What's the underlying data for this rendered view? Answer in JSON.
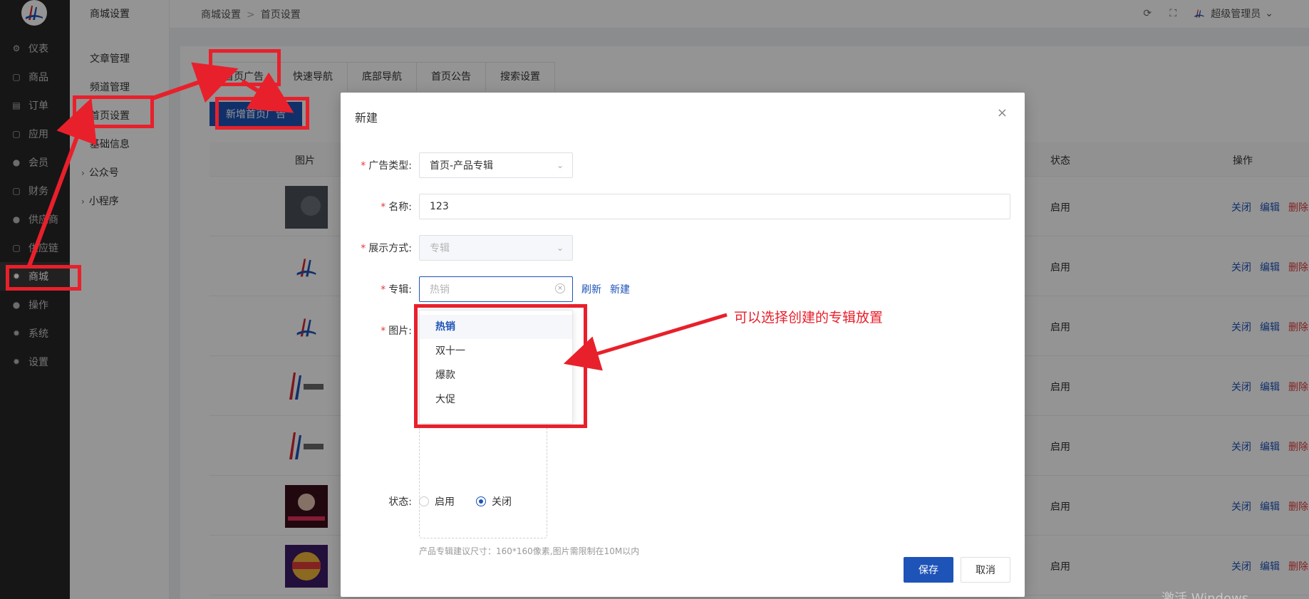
{
  "nav": {
    "items": [
      {
        "label": "仪表",
        "icon": "dashboard-icon",
        "glyph": "⚙"
      },
      {
        "label": "商品",
        "icon": "bag-icon",
        "glyph": "▢"
      },
      {
        "label": "订单",
        "icon": "order-icon",
        "glyph": "▤"
      },
      {
        "label": "应用",
        "icon": "app-icon",
        "glyph": "▢"
      },
      {
        "label": "会员",
        "icon": "user-icon",
        "glyph": "●"
      },
      {
        "label": "财务",
        "icon": "finance-icon",
        "glyph": "▢"
      },
      {
        "label": "供应商",
        "icon": "supplier-icon",
        "glyph": "●"
      },
      {
        "label": "供应链",
        "icon": "chain-icon",
        "glyph": "▢"
      },
      {
        "label": "商城",
        "icon": "gear-icon",
        "glyph": "✹",
        "active": true
      },
      {
        "label": "操作",
        "icon": "operator-icon",
        "glyph": "●"
      },
      {
        "label": "系统",
        "icon": "system-icon",
        "glyph": "✹"
      },
      {
        "label": "设置",
        "icon": "settings-icon",
        "glyph": "✹"
      }
    ]
  },
  "subnav": {
    "title": "商城设置",
    "items": [
      "文章管理",
      "频道管理",
      "首页设置",
      "基础信息",
      "公众号",
      "小程序"
    ]
  },
  "header": {
    "crumb_root": "商城设置",
    "crumb_sep": ">",
    "crumb_current": "首页设置",
    "refresh_glyph": "⟳",
    "fullscreen_glyph": "⛶",
    "admin_name": "超级管理员",
    "admin_caret": "⌄"
  },
  "tabs": [
    "首页广告",
    "快速导航",
    "底部导航",
    "首页公告",
    "搜索设置"
  ],
  "add_button": "新增首页广告",
  "table": {
    "col_image": "图片",
    "col_status": "状态",
    "col_ops": "操作",
    "rows": [
      {
        "status": "启用",
        "thumb": "dark"
      },
      {
        "status": "启用",
        "thumb": "logo"
      },
      {
        "status": "启用",
        "thumb": "logo"
      },
      {
        "status": "启用",
        "thumb": "logo-text"
      },
      {
        "status": "启用",
        "thumb": "logo-text"
      },
      {
        "status": "启用",
        "thumb": "portrait"
      },
      {
        "status": "启用",
        "thumb": "promo"
      }
    ],
    "op_close": "关闭",
    "op_edit": "编辑",
    "op_delete": "删除"
  },
  "modal": {
    "title": "新建",
    "close_glyph": "×",
    "ad_type_label": "广告类型:",
    "ad_type_value": "首页-产品专辑",
    "name_label": "名称:",
    "name_value": "123",
    "display_label": "展示方式:",
    "display_value": "专辑",
    "album_label": "专辑:",
    "album_placeholder": "热销",
    "refresh_link": "刷新",
    "new_link": "新建",
    "image_label": "图片:",
    "hint": "产品专辑建议尺寸：160*160像素,图片需限制在10M以内",
    "status_label": "状态:",
    "status_on": "启用",
    "status_off": "关闭",
    "save": "保存",
    "cancel": "取消",
    "arrow_glyph": "⌄"
  },
  "dropdown": {
    "options": [
      "热销",
      "双十一",
      "爆款",
      "大促"
    ],
    "selected_index": 0
  },
  "annotation": {
    "text": "可以选择创建的专辑放置",
    "color": "#e8202b"
  },
  "watermark": "激活 Windows",
  "colors": {
    "brand": "#1e53b7",
    "danger": "#e23b3b",
    "nav_bg": "#272727"
  }
}
